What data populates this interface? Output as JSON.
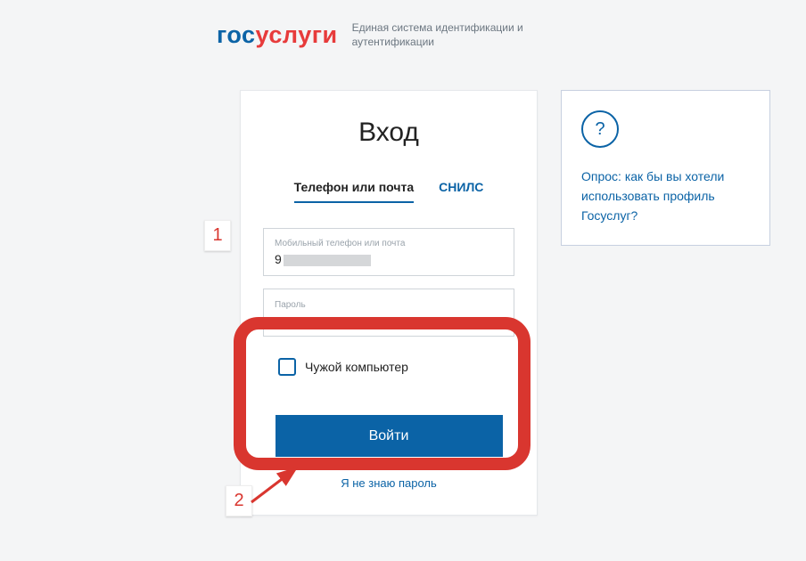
{
  "header": {
    "logo_part1": "гос",
    "logo_part2": "услуги",
    "tagline": "Единая система\nидентификации и аутентификации"
  },
  "login": {
    "title": "Вход",
    "tabs": {
      "phone_mail": "Телефон или почта",
      "snils": "СНИЛС"
    },
    "fields": {
      "login_label": "Мобильный телефон или почта",
      "login_value_prefix": "9",
      "password_label": "Пароль",
      "password_value": "••••••••••"
    },
    "checkbox_label": "Чужой компьютер",
    "submit": "Войти",
    "forgot": "Я не знаю пароль"
  },
  "poll": {
    "icon": "?",
    "text": "Опрос: как бы вы хотели использовать профиль Госуслуг?"
  },
  "annotations": {
    "step1": "1",
    "step2": "2"
  }
}
